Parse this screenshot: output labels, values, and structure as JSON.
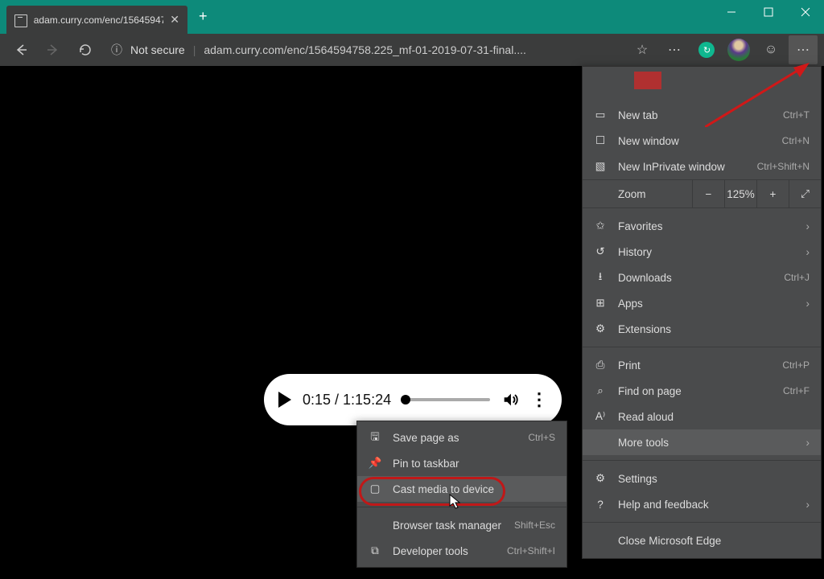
{
  "tab": {
    "title": "adam.curry.com/enc/15645947"
  },
  "url": {
    "not_secure": "Not secure",
    "address": "adam.curry.com/enc/1564594758.225_mf-01-2019-07-31-final...."
  },
  "media": {
    "time": "0:15 / 1:15:24"
  },
  "menu": {
    "new_tab": "New tab",
    "new_tab_sc": "Ctrl+T",
    "new_window": "New window",
    "new_window_sc": "Ctrl+N",
    "inprivate": "New InPrivate window",
    "inprivate_sc": "Ctrl+Shift+N",
    "zoom_label": "Zoom",
    "zoom_value": "125%",
    "favorites": "Favorites",
    "history": "History",
    "downloads": "Downloads",
    "downloads_sc": "Ctrl+J",
    "apps": "Apps",
    "extensions": "Extensions",
    "print": "Print",
    "print_sc": "Ctrl+P",
    "find": "Find on page",
    "find_sc": "Ctrl+F",
    "read_aloud": "Read aloud",
    "more_tools": "More tools",
    "settings": "Settings",
    "help": "Help and feedback",
    "close_edge": "Close Microsoft Edge"
  },
  "submenu": {
    "save_as": "Save page as",
    "save_as_sc": "Ctrl+S",
    "pin_taskbar": "Pin to taskbar",
    "cast": "Cast media to device",
    "task_mgr": "Browser task manager",
    "task_mgr_sc": "Shift+Esc",
    "dev_tools": "Developer tools",
    "dev_tools_sc": "Ctrl+Shift+I"
  }
}
